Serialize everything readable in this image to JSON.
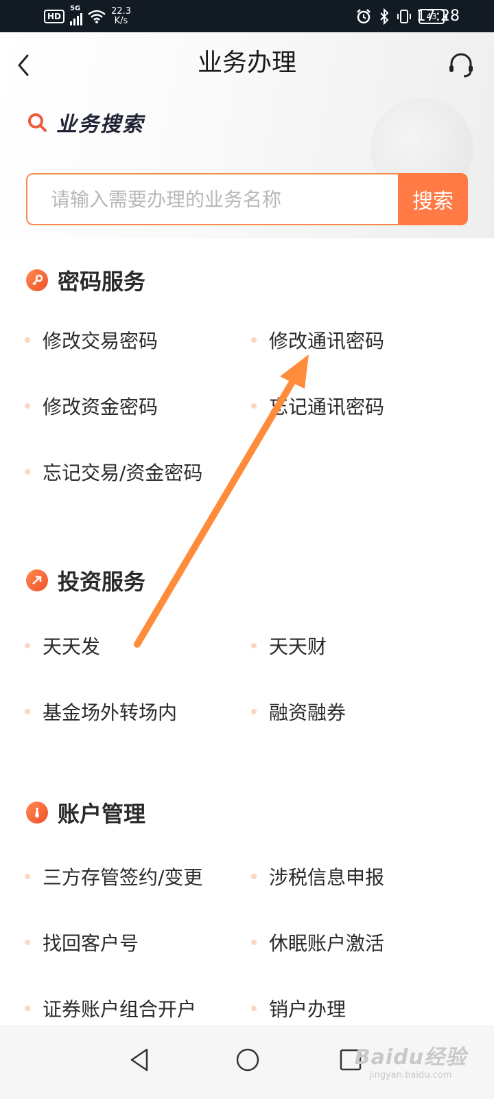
{
  "status_bar": {
    "hd": "HD",
    "network": "5G",
    "speed_value": "22.3",
    "speed_unit": "K/s",
    "battery": "43",
    "time": "17:28"
  },
  "header": {
    "title": "业务办理",
    "search_heading": "业务搜索",
    "search_placeholder": "请输入需要办理的业务名称",
    "search_value": "",
    "search_button": "搜索"
  },
  "sections": [
    {
      "title": "密码服务",
      "icon": "key-icon",
      "items": [
        "修改交易密码",
        "修改通讯密码",
        "修改资金密码",
        "忘记通讯密码",
        "忘记交易/资金密码"
      ]
    },
    {
      "title": "投资服务",
      "icon": "trend-up-icon",
      "items": [
        "天天发",
        "天天财",
        "基金场外转场内",
        "融资融券"
      ]
    },
    {
      "title": "账户管理",
      "icon": "tie-icon",
      "items": [
        "三方存管签约/变更",
        "涉税信息申报",
        "找回客户号",
        "休眠账户激活",
        "证券账户组合开户",
        "销户办理"
      ]
    }
  ],
  "watermark": {
    "main": "Baidu经验",
    "sub": "jingyan.baidu.com"
  },
  "colors": {
    "accent": "#ff7a45",
    "status_bar": "#121a24",
    "annotation_arrow": "#ff8c3a"
  }
}
